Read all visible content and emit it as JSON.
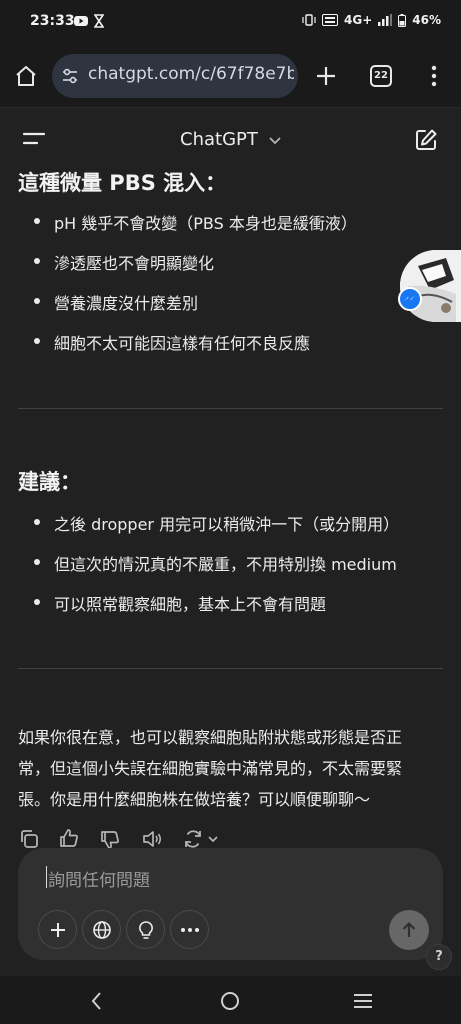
{
  "status_bar": {
    "time": "23:33",
    "network": "4G+",
    "battery": "46%"
  },
  "browser": {
    "url": "chatgpt.com/c/67f78e7b-",
    "tab_count": "22"
  },
  "app": {
    "title": "ChatGPT"
  },
  "message": {
    "partial_heading": "這種微量 PBS 混入：",
    "section1_bullets": [
      "pH 幾乎不會改變（PBS 本身也是緩衝液）",
      "滲透壓也不會明顯變化",
      "營養濃度沒什麼差別",
      "細胞不太可能因這樣有任何不良反應"
    ],
    "section2_heading": "建議：",
    "section2_bullets": [
      "之後 dropper 用完可以稍微沖一下（或分開用）",
      "但這次的情況真的不嚴重，不用特別換 medium",
      "可以照常觀察細胞，基本上不會有問題"
    ],
    "closing_lines": [
      "如果你很在意，也可以觀察細胞貼附狀態或形態是否正",
      "常，但這個小失誤在細胞實驗中滿常見的，不太需要緊",
      "張。你是用什麼細胞株在做培養？可以順便聊聊～"
    ]
  },
  "composer": {
    "placeholder": "詢問任何問題"
  },
  "help_label": "?",
  "colors": {
    "background": "#212121",
    "composer": "#303030",
    "text": "#ececec",
    "messenger_blue": "#1877f2"
  },
  "icons": {
    "message_actions": [
      "copy-icon",
      "thumbs-up-icon",
      "thumbs-down-icon",
      "read-aloud-icon",
      "regenerate-icon"
    ],
    "composer_tools": [
      "plus-icon",
      "globe-icon",
      "lightbulb-icon",
      "more-icon"
    ]
  }
}
